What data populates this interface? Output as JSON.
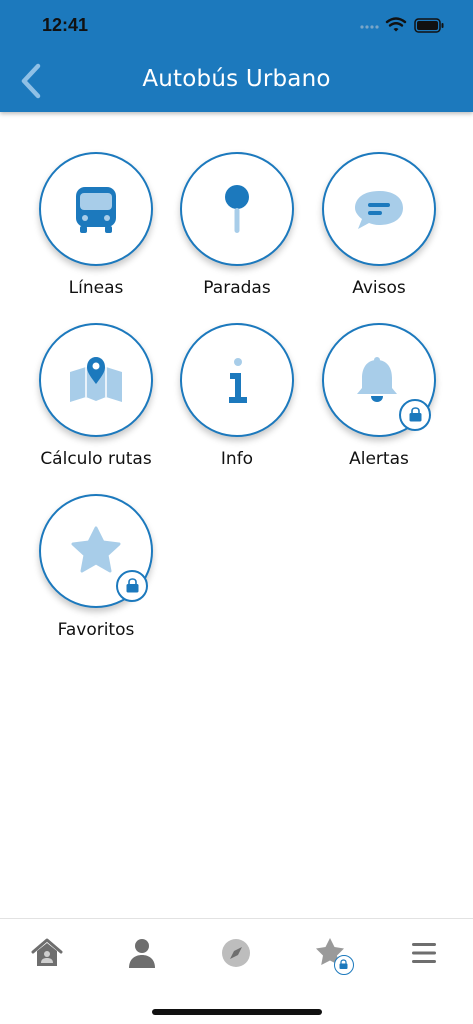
{
  "status_bar": {
    "time": "12:41"
  },
  "header": {
    "title": "Autobús Urbano",
    "back_icon": "chevron-left-icon"
  },
  "colors": {
    "primary": "#1c79bd",
    "light": "#a8cde9",
    "tab_icon": "#6e6e6e"
  },
  "menu": {
    "items": [
      {
        "label": "Líneas",
        "icon": "bus-icon",
        "locked": false
      },
      {
        "label": "Paradas",
        "icon": "pin-icon",
        "locked": false
      },
      {
        "label": "Avisos",
        "icon": "chat-icon",
        "locked": false
      },
      {
        "label": "Cálculo rutas",
        "icon": "map-icon",
        "locked": false
      },
      {
        "label": "Info",
        "icon": "info-icon",
        "locked": false
      },
      {
        "label": "Alertas",
        "icon": "bell-icon",
        "locked": true
      },
      {
        "label": "Favoritos",
        "icon": "star-icon",
        "locked": true
      }
    ]
  },
  "tabbar": {
    "items": [
      {
        "icon": "home-icon"
      },
      {
        "icon": "user-icon"
      },
      {
        "icon": "compass-icon"
      },
      {
        "icon": "star-icon",
        "locked": true
      },
      {
        "icon": "menu-icon"
      }
    ]
  }
}
